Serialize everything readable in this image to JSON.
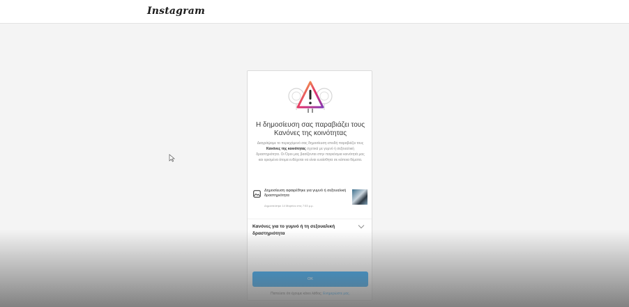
{
  "header": {
    "logo_text": "Instagram"
  },
  "dialog": {
    "title": "Η δημοσίευση σας παραβιάζει τους Κανόνες της κοινότητας",
    "description": {
      "part1": "Διαγράψαμε το περιεχόμενό σας δημοσίευση επειδή παραβιάζει τους ",
      "link": "Κανόνες της κοινότητας",
      "part2": " σχετικά με γυμνό ή σεξουαλική δραστηριότητα. Οι Όροι μας βασίζονται στην παγκόσμια κοινότητά μας και ορισμένα άτομα ενδέχεται να είναι ευαίσθητα σε κάποια θέματα."
    },
    "notice": {
      "icon": "image-icon",
      "text": "Δημοσίευση αφαιρέθηκε για γυμνό ή σεξουαλική δραστηριότητα",
      "date": "Δημοσιεύτηκε 14 Μαρτίου στις 7:53 μ.μ."
    },
    "rules_label": "Κανόνες για το γυμνό ή τη σεξουαλική δραστηριότητα",
    "ok_label": "OK",
    "footer": {
      "text": "Πιστεύετε ότι έχουμε κάνει λάθος; ",
      "link": "Ενημερώστε μας."
    }
  },
  "colors": {
    "accent": "#0095f6",
    "warning_gradient": [
      "#f9c33c",
      "#e1306c",
      "#833ab4"
    ]
  }
}
